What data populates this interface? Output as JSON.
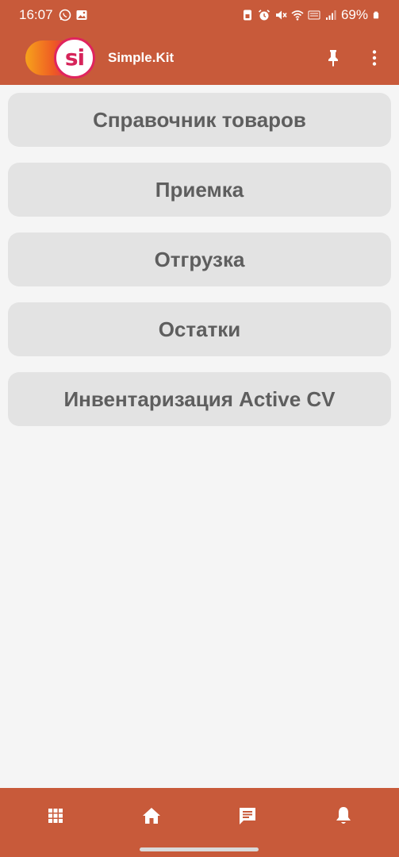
{
  "status_bar": {
    "time": "16:07",
    "battery": "69%",
    "left_icons": [
      "whatsapp-icon",
      "gallery-icon"
    ],
    "right_icons": [
      "sim-icon",
      "alarm-icon",
      "mute-icon",
      "wifi-icon",
      "volte-icon",
      "signal-icon",
      "battery-icon"
    ]
  },
  "app_bar": {
    "logo_text": "si",
    "title": "Simple.Kit",
    "actions": [
      "pin-icon",
      "more-vert-icon"
    ]
  },
  "menu": {
    "items": [
      {
        "label": "Справочник товаров"
      },
      {
        "label": "Приемка"
      },
      {
        "label": "Отгрузка"
      },
      {
        "label": "Остатки"
      },
      {
        "label": "Инвентаризация Active CV"
      }
    ]
  },
  "bottom_nav": {
    "items": [
      "apps-grid-icon",
      "home-icon",
      "chat-icon",
      "bell-icon"
    ]
  },
  "colors": {
    "bar": "#c85a3a",
    "background": "#f5f5f5",
    "button": "#e3e3e3",
    "button_text": "#5e5e5e"
  }
}
